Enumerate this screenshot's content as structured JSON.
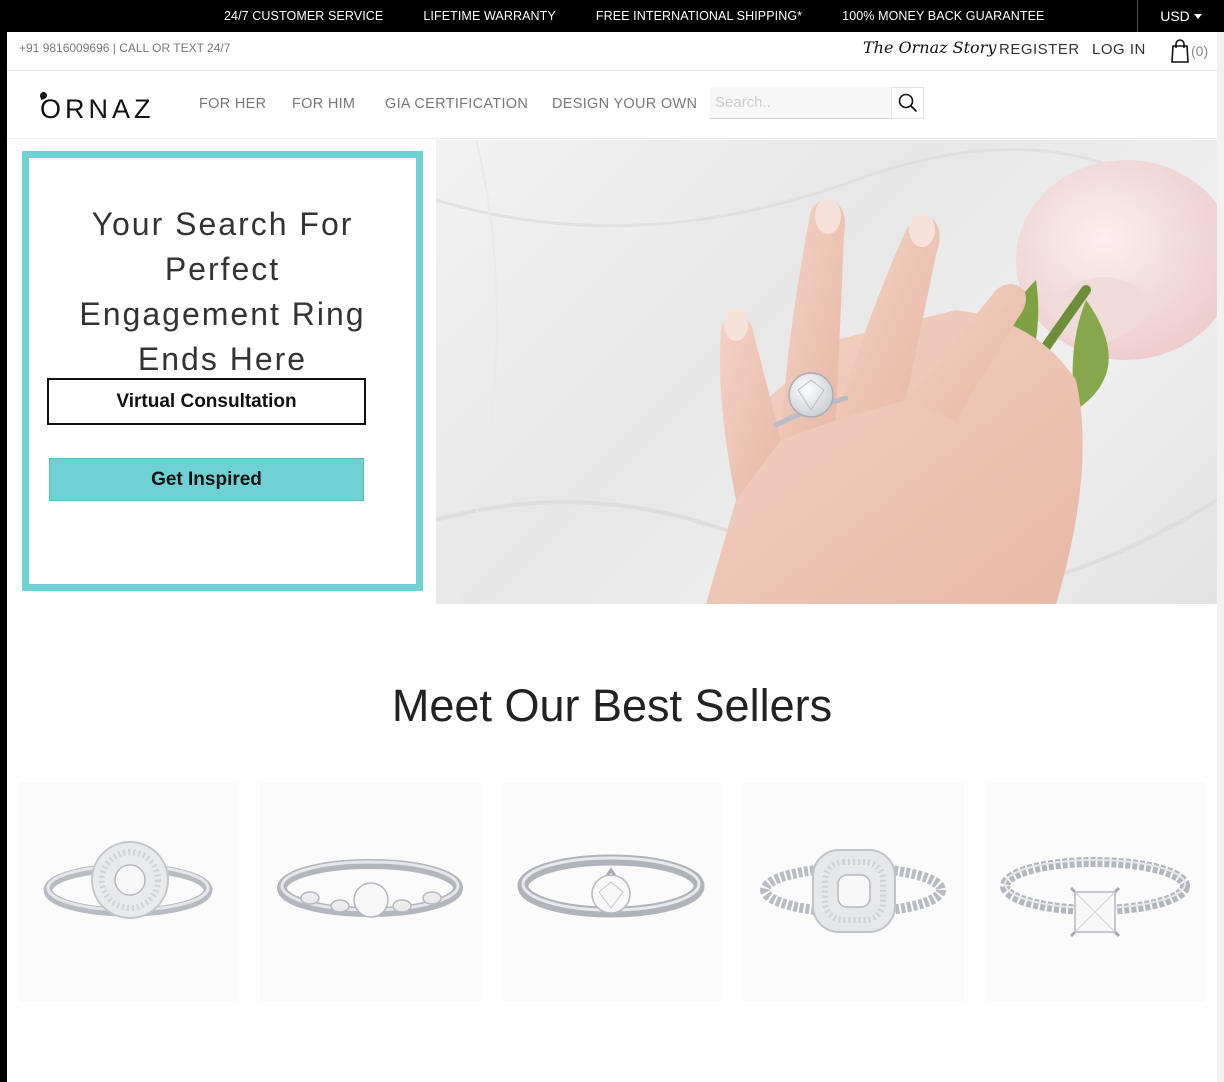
{
  "promo": {
    "items": [
      "24/7 CUSTOMER SERVICE",
      "LIFETIME WARRANTY",
      "FREE INTERNATIONAL SHIPPING*",
      "100% MONEY BACK GUARANTEE"
    ],
    "currency": "USD"
  },
  "utility": {
    "phone": "+91 9816009696 | CALL OR TEXT 24/7",
    "story_label": "The Ornaz Story",
    "register_label": "REGISTER",
    "login_label": "LOG IN",
    "cart_count": "(0)"
  },
  "nav": {
    "logo": "ORNAZ",
    "links": [
      "FOR HER",
      "FOR HIM",
      "GIA CERTIFICATION",
      "DESIGN YOUR OWN"
    ],
    "search_placeholder": "Search.."
  },
  "hero": {
    "title_lines": [
      "Your Search For",
      "Perfect",
      "Engagement Ring",
      "Ends Here"
    ],
    "virtual_consultation_label": "Virtual Consultation",
    "get_inspired_label": "Get Inspired"
  },
  "best_sellers": {
    "title": "Meet Our Best Sellers",
    "products": [
      {
        "style": "double-halo-split-shank"
      },
      {
        "style": "vintage-marquise-band"
      },
      {
        "style": "solitaire-six-prong"
      },
      {
        "style": "cushion-double-halo-pave"
      },
      {
        "style": "princess-pave-band"
      }
    ]
  },
  "colors": {
    "accent": "#6fd1d3",
    "promo_bg": "#000000"
  }
}
